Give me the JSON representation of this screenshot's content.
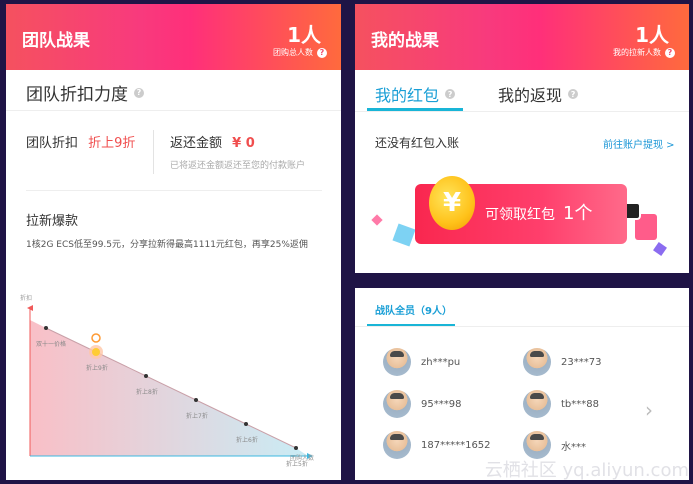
{
  "team_result": {
    "title": "团队战果",
    "count": "1人",
    "count_label": "团购总人数",
    "discount_section_title": "团队折扣力度",
    "team_discount_label": "团队折扣",
    "team_discount_value": "折上9折",
    "refund_label": "返还金额",
    "refund_value": "¥ 0",
    "refund_note": "已将返还金额返还至您的付款账户",
    "promo_title": "拉新爆款",
    "promo_text": "1核2G ECS低至99.5元，分享拉新得最高1111元红包，再享25%返佣"
  },
  "chart_data": {
    "type": "line",
    "ylabel": "折扣",
    "xlabel": "团购人数",
    "categories": [
      "双十一价格",
      "折上9折",
      "折上8折",
      "折上7折",
      "折上6折",
      "折上5折"
    ],
    "values": [
      6,
      5,
      4,
      3,
      2,
      1
    ],
    "current_index": 1
  },
  "my_result": {
    "title": "我的战果",
    "count": "1人",
    "count_label": "我的拉新人数",
    "tabs": [
      {
        "label": "我的红包"
      },
      {
        "label": "我的返现"
      }
    ],
    "empty_text": "还没有红包入账",
    "link_text": "前往账户提现 >",
    "redpacket_label": "可领取红包",
    "redpacket_count": "1个",
    "coin_symbol": "¥"
  },
  "members": {
    "tab_label": "战队全员（9人）",
    "list": [
      {
        "name": "zh***pu"
      },
      {
        "name": "23***73"
      },
      {
        "name": "95***98"
      },
      {
        "name": "tb***88"
      },
      {
        "name": "187*****1652"
      },
      {
        "name": "水***"
      }
    ],
    "next_symbol": "›"
  },
  "watermark": "云栖社区 yq.aliyun.com"
}
